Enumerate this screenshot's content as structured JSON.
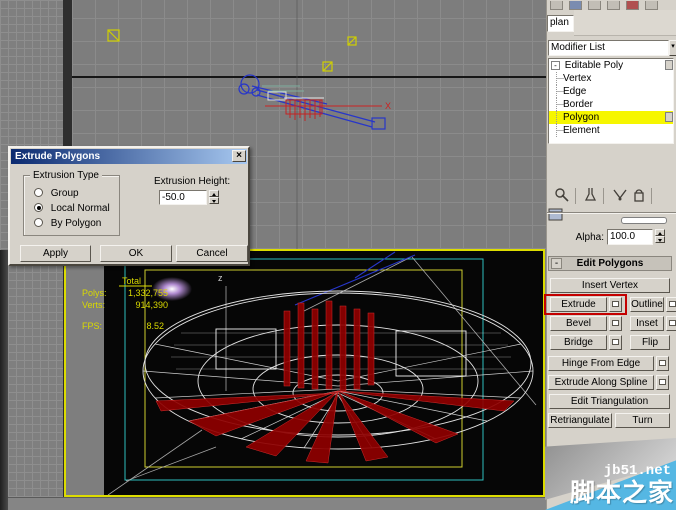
{
  "dialog": {
    "title": "Extrude Polygons",
    "close_label": "x",
    "group_title": "Extrusion Type",
    "radios": [
      {
        "label": "Group",
        "selected": false
      },
      {
        "label": "Local Normal",
        "selected": true
      },
      {
        "label": "By Polygon",
        "selected": false
      }
    ],
    "height_label": "Extrusion Height:",
    "height_value": "-50.0",
    "apply_label": "Apply",
    "ok_label": "OK",
    "cancel_label": "Cancel"
  },
  "panel": {
    "name_field": "plan",
    "modifier_list_label": "Modifier List",
    "stack": {
      "expander": "-",
      "root": "Editable Poly",
      "children": [
        "Vertex",
        "Edge",
        "Border",
        "Polygon",
        "Element"
      ],
      "selected": "Polygon"
    },
    "alpha_label": "Alpha:",
    "alpha_value": "100.0",
    "rollout": {
      "collapse": "-",
      "title": "Edit Polygons"
    },
    "buttons": {
      "insert_vertex": "Insert Vertex",
      "extrude": "Extrude",
      "outline": "Outline",
      "bevel": "Bevel",
      "inset": "Inset",
      "bridge": "Bridge",
      "flip": "Flip",
      "hinge_from_edge": "Hinge From Edge",
      "extrude_along_spline": "Extrude Along Spline",
      "edit_triangulation": "Edit Triangulation",
      "retriangulate": "Retriangulate",
      "turn": "Turn"
    }
  },
  "viewport": {
    "stats": {
      "total_label": "Total",
      "polys_label": "Polys:",
      "polys_value": "1,332,755",
      "verts_label": "Verts:",
      "verts_value": "914,390",
      "fps_label": "FPS:",
      "fps_value": "8.52"
    },
    "axis_x_label": "X",
    "axis_z_label": "z"
  },
  "watermark": {
    "site": "jb51.net",
    "name": "脚本之家"
  },
  "colors": {
    "active_viewport_border": "#dcdc00",
    "selection_highlight": "#f6f600",
    "selected_poly_red": "#8f0000",
    "stats_yellow": "#d9d900",
    "watermark_blue": "#55b7e3",
    "extrude_highlight_red": "#c40000"
  }
}
